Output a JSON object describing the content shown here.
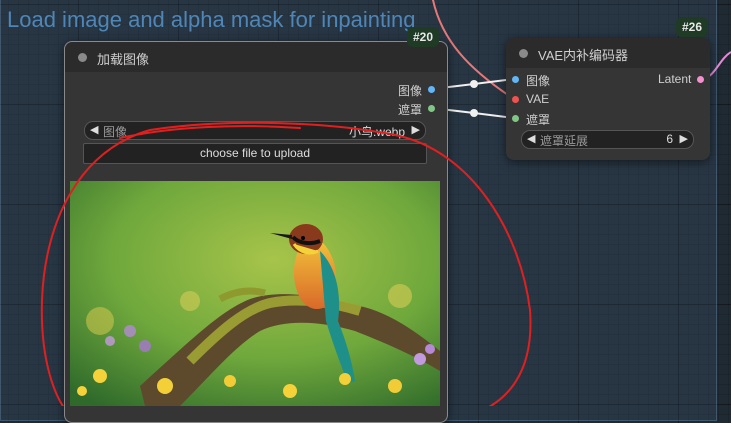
{
  "group": {
    "title": "Load image and alpha mask for inpainting"
  },
  "load_image_node": {
    "id_badge": "#20",
    "title": "加载图像",
    "outputs": [
      {
        "label": "图像",
        "color": "#64b5f6"
      },
      {
        "label": "遮罩",
        "color": "#81c784"
      }
    ],
    "image_widget": {
      "label": "图像",
      "value": "小鸟.webp"
    },
    "upload_label": "choose file to upload",
    "preview_subject": "bee-eater bird on mossy branch"
  },
  "vae_encode_node": {
    "id_badge": "#26",
    "title": "VAE内补编码器",
    "inputs": [
      {
        "label": "图像",
        "color": "#64b5f6"
      },
      {
        "label": "VAE",
        "color": "#ef5350"
      },
      {
        "label": "遮罩",
        "color": "#81c784"
      }
    ],
    "output": {
      "label": "Latent",
      "color": "#f48fd0"
    },
    "mask_grow_widget": {
      "label": "遮罩延展",
      "value": "6"
    }
  },
  "colors": {
    "canvas": "#202a33",
    "node_body": "#353535",
    "node_header": "#2b2b2b",
    "group_title": "#4f86b6",
    "badge_bg": "#1f3a25",
    "annotation": "#e02020"
  }
}
